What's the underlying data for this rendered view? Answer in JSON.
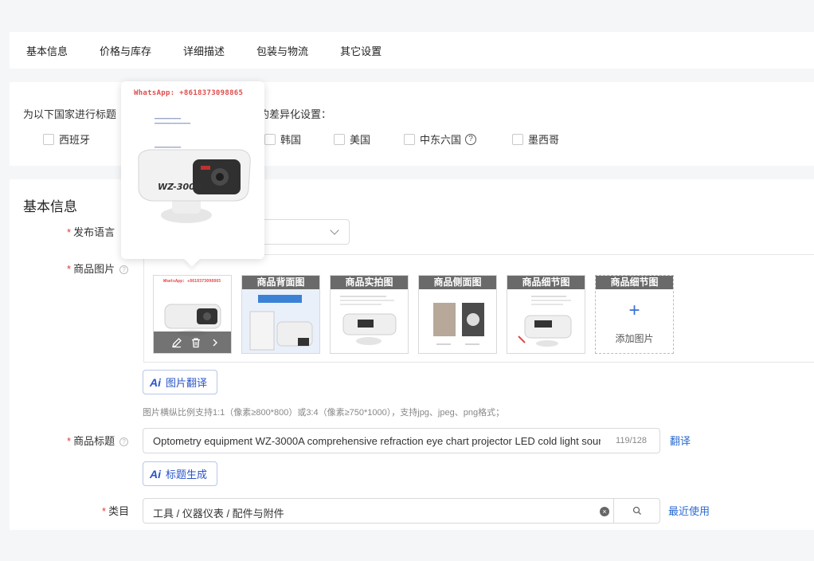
{
  "tabs": [
    "基本信息",
    "价格与库存",
    "详细描述",
    "包装与物流",
    "其它设置"
  ],
  "country_section": {
    "prompt_start": "为以下国家进行标题",
    "prompt_end": "容的差异化设置：",
    "countries": [
      "西班牙",
      "韩国",
      "美国",
      "中东六国",
      "墨西哥"
    ],
    "help_glyph": "?"
  },
  "basic_info": {
    "title": "基本信息",
    "language_label": "发布语言",
    "images_label": "商品图片",
    "image_captions": [
      "商品背面图",
      "商品实拍图",
      "商品侧面图",
      "商品细节图",
      "商品细节图"
    ],
    "add_image_label": "添加图片",
    "add_image_icon": "+",
    "ai_tag": "Ai",
    "translate_images_button": "图片翻译",
    "image_hint": "图片横纵比例支持1:1（像素≥800*800）或3:4（像素≥750*1000），支持jpg、jpeg、png格式；",
    "product_title_label": "商品标题",
    "product_title_value": "Optometry equipment WZ-3000A comprehensive refraction eye chart projector LED cold light source",
    "title_count": "119/128",
    "translate_link": "翻译",
    "generate_title_button": "标题生成",
    "category_label": "类目",
    "category_value": "工具 / 仪器仪表 / 配件与附件",
    "clear_glyph": "×",
    "recent_link": "最近使用",
    "required_mark": "*",
    "help_mark": "?"
  },
  "popup": {
    "whatsapp": "WhatsApp: +8618373098865",
    "product_label": "WZ-3000"
  },
  "colors": {
    "accent": "#2a6bd1",
    "required": "#e4393c",
    "watermark": "#e04b4b"
  }
}
